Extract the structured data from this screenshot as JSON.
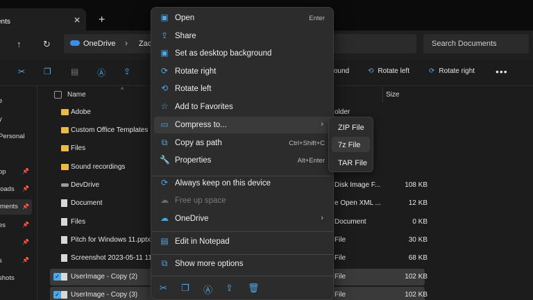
{
  "tab": {
    "title": "ents"
  },
  "address": {
    "segment1": "OneDrive",
    "segment2": "Zac",
    "search_placeholder": "Search Documents"
  },
  "toolbar": {
    "round": "ound",
    "rotate_left": "Rotate left",
    "rotate_right": "Rotate right"
  },
  "sidebar": {
    "items": [
      {
        "label": "e"
      },
      {
        "label": "y"
      },
      {
        "label": "Personal"
      },
      {
        "label": "op"
      },
      {
        "label": "loads"
      },
      {
        "label": "ments"
      },
      {
        "label": "es"
      },
      {
        "label": "s"
      },
      {
        "label": "shots"
      }
    ]
  },
  "filelist": {
    "headers": {
      "name": "Name",
      "size": "Size"
    },
    "rows": [
      {
        "name": "Adobe",
        "type": "older",
        "size": "",
        "icon": "folder",
        "selected": false
      },
      {
        "name": "Custom Office Templates",
        "type": "",
        "size": "",
        "icon": "folder",
        "selected": false
      },
      {
        "name": "Files",
        "type": "",
        "size": "",
        "icon": "folder",
        "selected": false
      },
      {
        "name": "Sound recordings",
        "type": "",
        "size": "",
        "icon": "folder",
        "selected": false
      },
      {
        "name": "DevDrive",
        "type": "Disk Image F...",
        "size": "108 KB",
        "icon": "drive",
        "selected": false
      },
      {
        "name": "Document",
        "type": "e Open XML ...",
        "size": "12 KB",
        "icon": "doc",
        "selected": false
      },
      {
        "name": "Files",
        "type": "Document",
        "size": "0 KB",
        "icon": "doc",
        "selected": false
      },
      {
        "name": "Pitch for Windows 11.pptx",
        "type": "File",
        "size": "30 KB",
        "icon": "doc",
        "selected": false
      },
      {
        "name": "Screenshot 2023-05-11 111",
        "type": "File",
        "size": "68 KB",
        "icon": "doc",
        "selected": false
      },
      {
        "name": "UserImage - Copy (2)",
        "type": "File",
        "size": "102 KB",
        "icon": "doc",
        "selected": true
      },
      {
        "name": "UserImage - Copy (3)",
        "type": "File",
        "size": "102 KB",
        "icon": "doc",
        "selected": true
      }
    ]
  },
  "context_menu": {
    "items": [
      {
        "label": "Open",
        "shortcut": "Enter",
        "icon": "open-icon"
      },
      {
        "label": "Share",
        "shortcut": "",
        "icon": "share-icon"
      },
      {
        "label": "Set as desktop background",
        "shortcut": "",
        "icon": "desktop-background-icon"
      },
      {
        "label": "Rotate right",
        "shortcut": "",
        "icon": "rotate-right-icon"
      },
      {
        "label": "Rotate left",
        "shortcut": "",
        "icon": "rotate-left-icon"
      },
      {
        "label": "Add to Favorites",
        "shortcut": "",
        "icon": "star-icon"
      },
      {
        "label": "Compress to...",
        "shortcut": "",
        "icon": "compress-icon",
        "submenu": true
      },
      {
        "label": "Copy as path",
        "shortcut": "Ctrl+Shift+C",
        "icon": "copy-path-icon"
      },
      {
        "label": "Properties",
        "shortcut": "Alt+Enter",
        "icon": "wrench-icon"
      },
      {
        "label": "Always keep on this device",
        "shortcut": "",
        "icon": "keep-device-icon"
      },
      {
        "label": "Free up space",
        "shortcut": "",
        "icon": "cloud-icon",
        "disabled": true
      },
      {
        "label": "OneDrive",
        "shortcut": "",
        "icon": "onedrive-icon",
        "submenu": true
      },
      {
        "label": "Edit in Notepad",
        "shortcut": "",
        "icon": "notepad-icon"
      },
      {
        "label": "Show more options",
        "shortcut": "",
        "icon": "more-options-icon"
      }
    ]
  },
  "compress_submenu": {
    "items": [
      {
        "label": "ZIP File"
      },
      {
        "label": "7z File"
      },
      {
        "label": "TAR File"
      }
    ]
  }
}
